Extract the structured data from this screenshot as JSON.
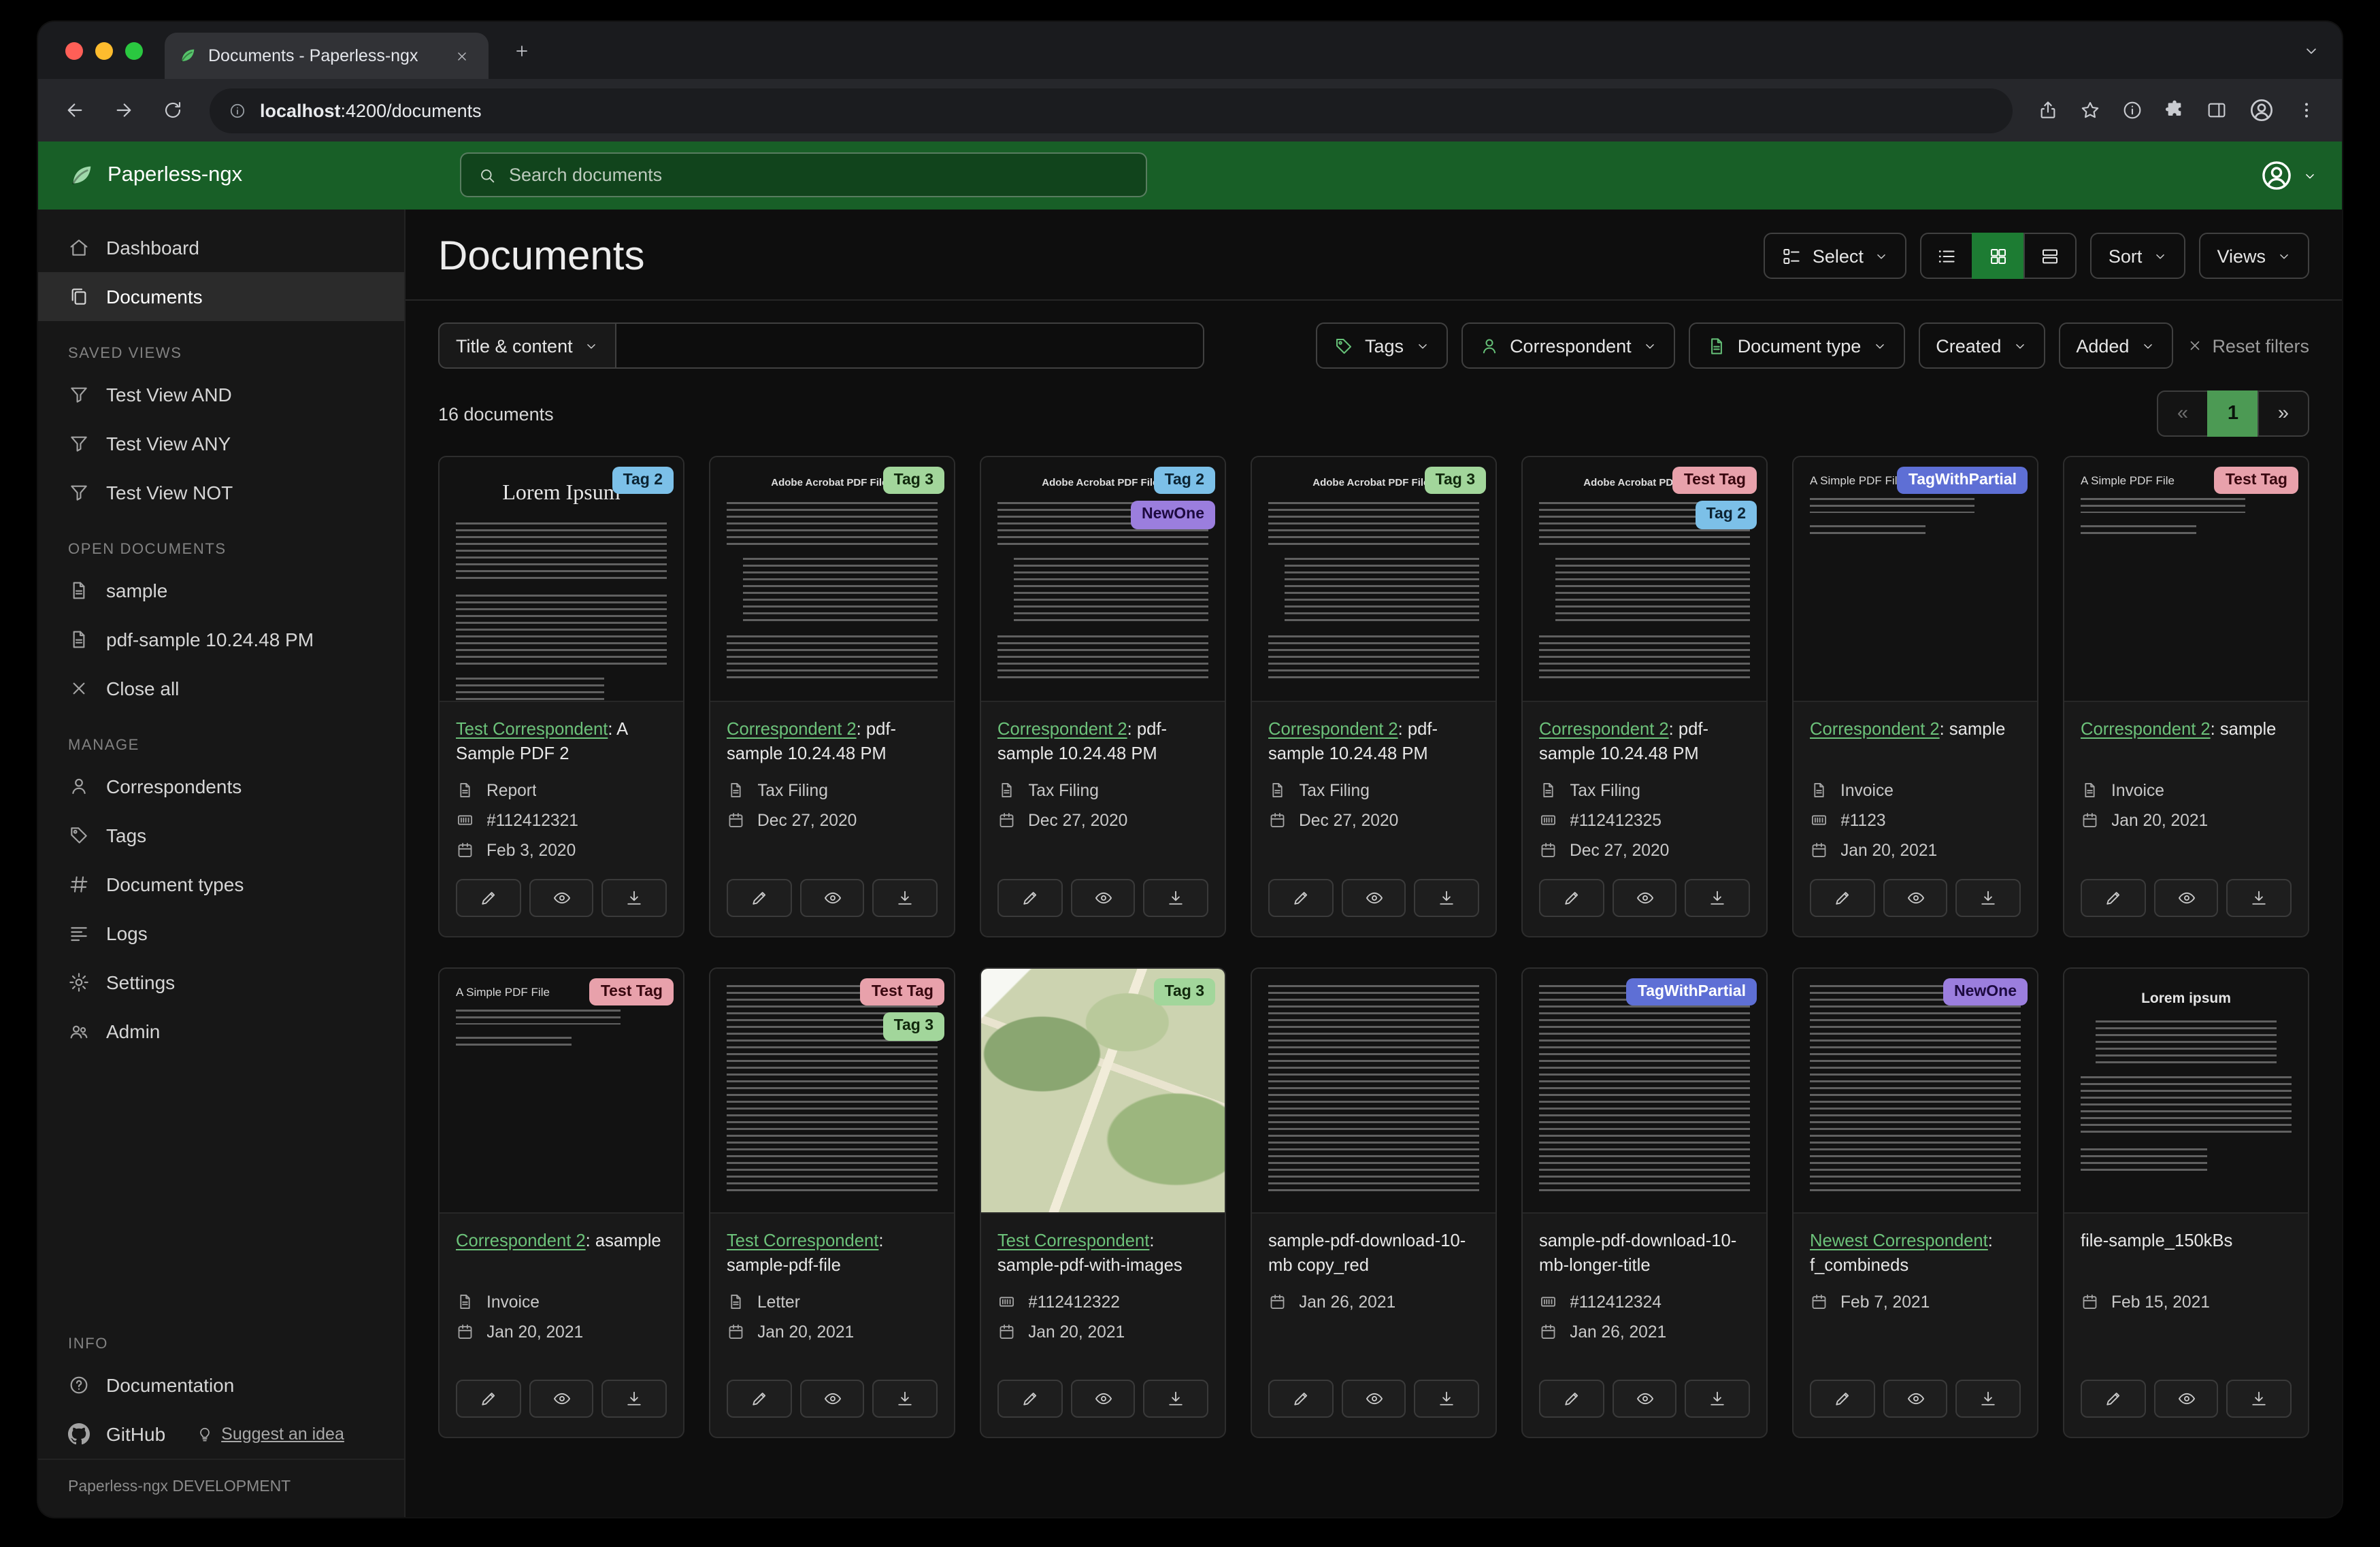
{
  "browser": {
    "tab_title": "Documents - Paperless-ngx",
    "url_host": "localhost",
    "url_rest": ":4200/documents"
  },
  "app_header": {
    "brand": "Paperless-ngx",
    "search_placeholder": "Search documents"
  },
  "sidebar": {
    "nav": [
      {
        "label": "Dashboard"
      },
      {
        "label": "Documents"
      }
    ],
    "saved_views_heading": "SAVED VIEWS",
    "saved_views": [
      {
        "label": "Test View AND"
      },
      {
        "label": "Test View ANY"
      },
      {
        "label": "Test View NOT"
      }
    ],
    "open_documents_heading": "OPEN DOCUMENTS",
    "open_documents": [
      {
        "label": "sample"
      },
      {
        "label": "pdf-sample 10.24.48 PM"
      }
    ],
    "close_all_label": "Close all",
    "manage_heading": "MANAGE",
    "manage": [
      {
        "label": "Correspondents"
      },
      {
        "label": "Tags"
      },
      {
        "label": "Document types"
      },
      {
        "label": "Logs"
      },
      {
        "label": "Settings"
      },
      {
        "label": "Admin"
      }
    ],
    "info_heading": "INFO",
    "documentation_label": "Documentation",
    "github_label": "GitHub",
    "suggest_label": "Suggest an idea",
    "footer": "Paperless-ngx DEVELOPMENT"
  },
  "content": {
    "page_title": "Documents",
    "select_label": "Select",
    "sort_label": "Sort",
    "views_label": "Views",
    "filter_title_content": "Title & content",
    "filter_input_value": "",
    "filter_tags": "Tags",
    "filter_correspondent": "Correspondent",
    "filter_document_type": "Document type",
    "filter_created": "Created",
    "filter_added": "Added",
    "reset_filters": "Reset filters",
    "count_text": "16 documents",
    "pagination": {
      "prev": "«",
      "current": "1",
      "next": "»"
    }
  },
  "colors": {
    "header_green": "#185f27",
    "accent_green": "#6cc27a",
    "active_view_green": "#1d7c33",
    "pagination_active_green": "#4c9a54"
  },
  "tag_colors": {
    "Tag 2": {
      "bg": "#7cc0e8",
      "fg": "#0c2433"
    },
    "Tag 3": {
      "bg": "#a2d69b",
      "fg": "#11290d"
    },
    "NewOne": {
      "bg": "#9b7ede",
      "fg": "#1d0a40"
    },
    "Test Tag": {
      "bg": "#e8a1ab",
      "fg": "#38070f"
    },
    "TagWithPartial": {
      "bg": "#5e6fd5",
      "fg": "#ffffff"
    }
  },
  "icons": {
    "paperless-logo-icon": "leaf",
    "search-icon": "magnifier",
    "user-menu-icon": "person-circle",
    "dashboard-icon": "house",
    "documents-icon": "stacked-pages",
    "saved-view-icon": "funnel",
    "open-document-icon": "file-text",
    "close-all-icon": "x",
    "correspondents-icon": "person",
    "tags-icon": "tag",
    "document-types-icon": "hash",
    "logs-icon": "text-lines",
    "settings-icon": "gear",
    "admin-icon": "people",
    "documentation-icon": "question-circle",
    "github-icon": "github-mark",
    "suggest-idea-icon": "lightbulb",
    "select-icon": "checklist",
    "view-list-icon": "list",
    "view-grid-icon": "grid",
    "view-details-icon": "rows",
    "edit-icon": "pencil",
    "preview-icon": "eye",
    "download-icon": "down-arrow-tray",
    "asn-icon": "card-code",
    "date-icon": "calendar",
    "reset-icon": "x"
  },
  "documents": [
    {
      "tags": [
        "Tag 2"
      ],
      "thumb": {
        "kind": "serif",
        "heading": "Lorem Ipsum"
      },
      "title_link": "Test Correspondent",
      "title_rest": ": A Sample PDF 2",
      "doc_type": "Report",
      "asn": "#112412321",
      "date": "Feb 3, 2020"
    },
    {
      "tags": [
        "Tag 3"
      ],
      "thumb": {
        "kind": "acrobat",
        "heading": "Adobe Acrobat PDF Files"
      },
      "title_link": "Correspondent 2",
      "title_rest": ": pdf-sample 10.24.48 PM",
      "doc_type": "Tax Filing",
      "asn": null,
      "date": "Dec 27, 2020"
    },
    {
      "tags": [
        "Tag 2",
        "NewOne"
      ],
      "thumb": {
        "kind": "acrobat",
        "heading": "Adobe Acrobat PDF Files"
      },
      "title_link": "Correspondent 2",
      "title_rest": ": pdf-sample 10.24.48 PM",
      "doc_type": "Tax Filing",
      "asn": null,
      "date": "Dec 27, 2020"
    },
    {
      "tags": [
        "Tag 3"
      ],
      "thumb": {
        "kind": "acrobat",
        "heading": "Adobe Acrobat PDF Files"
      },
      "title_link": "Correspondent 2",
      "title_rest": ": pdf-sample 10.24.48 PM",
      "doc_type": "Tax Filing",
      "asn": null,
      "date": "Dec 27, 2020"
    },
    {
      "tags": [
        "Test Tag",
        "Tag 2"
      ],
      "thumb": {
        "kind": "acrobat",
        "heading": "Adobe Acrobat PDF Files"
      },
      "title_link": "Correspondent 2",
      "title_rest": ": pdf-sample 10.24.48 PM",
      "doc_type": "Tax Filing",
      "asn": "#112412325",
      "date": "Dec 27, 2020"
    },
    {
      "tags": [
        "TagWithPartial"
      ],
      "thumb": {
        "kind": "simple",
        "heading": "A Simple PDF File"
      },
      "title_link": "Correspondent 2",
      "title_rest": ": sample",
      "doc_type": "Invoice",
      "asn": "#1123",
      "date": "Jan 20, 2021"
    },
    {
      "tags": [
        "Test Tag"
      ],
      "thumb": {
        "kind": "simple",
        "heading": "A Simple PDF File"
      },
      "title_link": "Correspondent 2",
      "title_rest": ": sample",
      "doc_type": "Invoice",
      "asn": null,
      "date": "Jan 20, 2021"
    },
    {
      "tags": [
        "Test Tag"
      ],
      "thumb": {
        "kind": "simple",
        "heading": "A Simple PDF File"
      },
      "title_link": "Correspondent 2",
      "title_rest": ": asample",
      "doc_type": "Invoice",
      "asn": null,
      "date": "Jan 20, 2021"
    },
    {
      "tags": [
        "Test Tag",
        "Tag 3"
      ],
      "thumb": {
        "kind": "dense",
        "heading": null
      },
      "title_link": "Test Correspondent",
      "title_rest": ": sample-pdf-file",
      "doc_type": "Letter",
      "asn": null,
      "date": "Jan 20, 2021"
    },
    {
      "tags": [
        "Tag 3"
      ],
      "thumb": {
        "kind": "map",
        "heading": null
      },
      "title_link": "Test Correspondent",
      "title_rest": ": sample-pdf-with-images",
      "doc_type": null,
      "asn": "#112412322",
      "date": "Jan 20, 2021"
    },
    {
      "tags": [],
      "thumb": {
        "kind": "dense",
        "heading": null
      },
      "title_link": null,
      "title_rest": "sample-pdf-download-10-mb copy_red",
      "doc_type": null,
      "asn": null,
      "date": "Jan 26, 2021"
    },
    {
      "tags": [
        "TagWithPartial"
      ],
      "thumb": {
        "kind": "dense",
        "heading": null
      },
      "title_link": null,
      "title_rest": "sample-pdf-download-10-mb-longer-title",
      "doc_type": null,
      "asn": "#112412324",
      "date": "Jan 26, 2021"
    },
    {
      "tags": [
        "NewOne"
      ],
      "thumb": {
        "kind": "dense",
        "heading": null
      },
      "title_link": "Newest Correspondent",
      "title_rest": ": f_combineds",
      "doc_type": null,
      "asn": null,
      "date": "Feb 7, 2021"
    },
    {
      "tags": [],
      "thumb": {
        "kind": "center",
        "heading": "Lorem ipsum"
      },
      "title_link": null,
      "title_rest": "file-sample_150kBs",
      "doc_type": null,
      "asn": null,
      "date": "Feb 15, 2021"
    }
  ]
}
